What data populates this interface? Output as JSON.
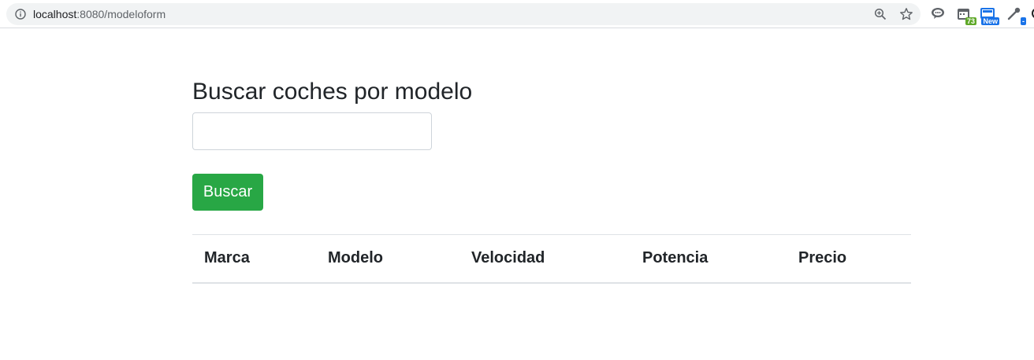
{
  "browser": {
    "url_host": "localhost",
    "url_rest": ":8080/modeloform",
    "icons": {
      "info": "info-icon",
      "zoom": "zoom-icon",
      "bookmark": "star-icon"
    },
    "extensions": [
      {
        "name": "chat-bubble-extension-icon",
        "badge": ""
      },
      {
        "name": "calendar-extension-icon",
        "badge": "73"
      },
      {
        "name": "new-extension-icon",
        "badge": "New"
      },
      {
        "name": "eyedropper-extension-icon",
        "badge": "-"
      },
      {
        "name": "extension-icon",
        "badge": ""
      }
    ]
  },
  "page": {
    "title": "Buscar coches por modelo",
    "search_value": "",
    "button_label": "Buscar"
  },
  "table": {
    "headers": [
      "Marca",
      "Modelo",
      "Velocidad",
      "Potencia",
      "Precio"
    ],
    "rows": []
  },
  "colors": {
    "button_bg": "#28a745",
    "text": "#212529",
    "border": "#dee2e6"
  }
}
